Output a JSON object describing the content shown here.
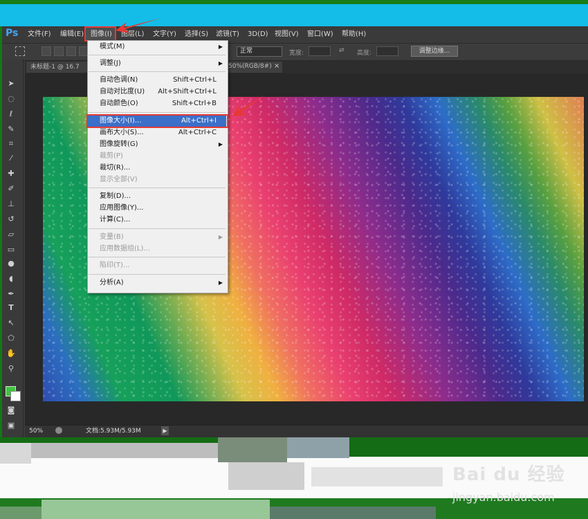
{
  "app": {
    "logo": "Ps"
  },
  "menubar": {
    "items": [
      "文件(F)",
      "编辑(E)",
      "图像(I)",
      "图层(L)",
      "文字(Y)",
      "选择(S)",
      "滤镜(T)",
      "3D(D)",
      "视图(V)",
      "窗口(W)",
      "帮助(H)"
    ]
  },
  "options_bar": {
    "style_value": "正常",
    "width_label": "宽度:",
    "height_label": "高度:",
    "refine_edge_button": "调整边缘..."
  },
  "document": {
    "tab_title": "未标题-1 @ 16.7",
    "tab_suffix": "50%(RGB/8#)",
    "close_glyph": "×"
  },
  "image_menu": {
    "mode": "模式(M)",
    "adjust": "调整(J)",
    "auto_tone": "自动色调(N)",
    "auto_tone_sc": "Shift+Ctrl+L",
    "auto_contrast": "自动对比度(U)",
    "auto_contrast_sc": "Alt+Shift+Ctrl+L",
    "auto_color": "自动颜色(O)",
    "auto_color_sc": "Shift+Ctrl+B",
    "image_size": "图像大小(I)...",
    "image_size_sc": "Alt+Ctrl+I",
    "canvas_size": "画布大小(S)...",
    "canvas_size_sc": "Alt+Ctrl+C",
    "image_rotation": "图像旋转(G)",
    "crop": "裁剪(P)",
    "trim": "裁切(R)...",
    "reveal_all": "显示全部(V)",
    "duplicate": "复制(D)...",
    "apply_image": "应用图像(Y)...",
    "calculations": "计算(C)...",
    "variables": "变量(B)",
    "apply_data_set": "应用数据组(L)...",
    "trap": "陷印(T)...",
    "analysis": "分析(A)",
    "submenu_arrow": "▶"
  },
  "statusbar": {
    "zoom": "50%",
    "doc_info": "文档:5.93M/5.93M",
    "arrow": "▶"
  },
  "watermark": {
    "logo": "Bai du 经验",
    "sub": "jingyan.baidu.com"
  },
  "colors": {
    "highlight_red": "#e53935",
    "menu_selected": "#3b6fc8",
    "foreground": "#3fc43f",
    "background": "#ffffff"
  }
}
